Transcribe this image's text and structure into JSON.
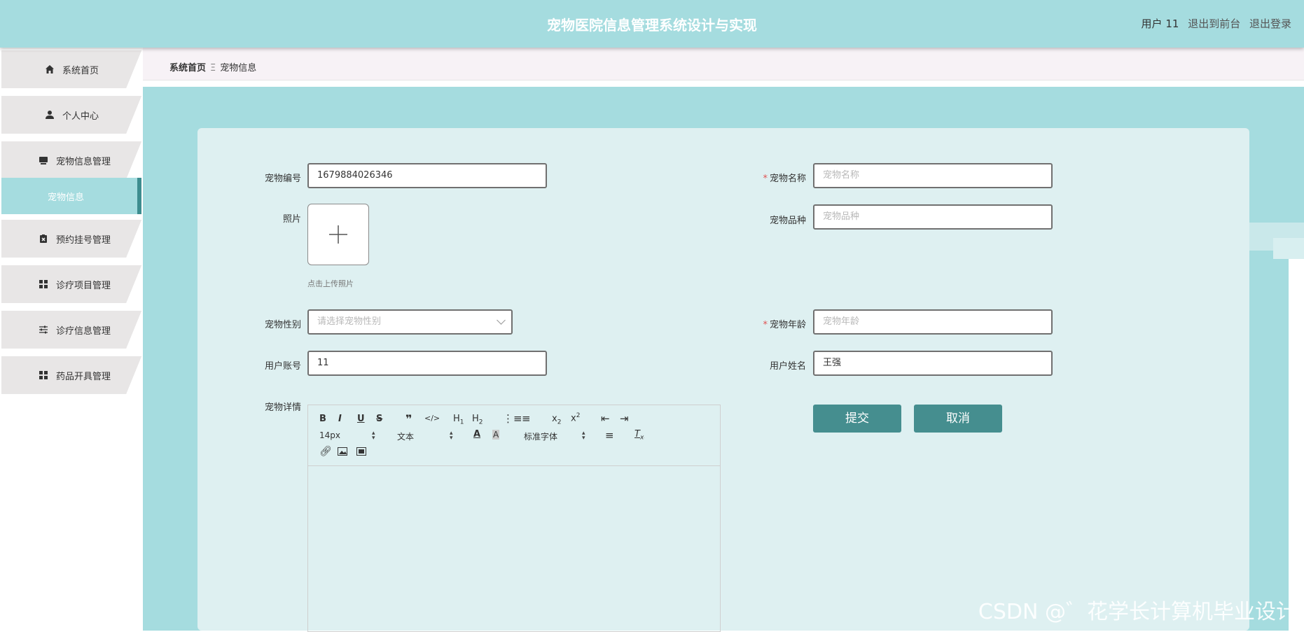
{
  "header": {
    "title": "宠物医院信息管理系统设计与实现",
    "user_label": "用户 11",
    "front_link": "退出到前台",
    "logout_link": "退出登录"
  },
  "sidebar": {
    "items": [
      {
        "label": "系统首页",
        "icon": "home-icon"
      },
      {
        "label": "个人中心",
        "icon": "user-icon"
      },
      {
        "label": "宠物信息管理",
        "icon": "monitor-icon"
      },
      {
        "label": "预约挂号管理",
        "icon": "clipboard-icon"
      },
      {
        "label": "诊疗项目管理",
        "icon": "grid-icon"
      },
      {
        "label": "诊疗信息管理",
        "icon": "sliders-icon"
      },
      {
        "label": "药品开具管理",
        "icon": "grid-icon"
      }
    ],
    "submenu_active": "宠物信息"
  },
  "breadcrumb": {
    "root": "系统首页",
    "separator": "Ξ",
    "current": "宠物信息"
  },
  "form": {
    "pet_no": {
      "label": "宠物编号",
      "value": "1679884026346"
    },
    "pet_name": {
      "label": "宠物名称",
      "placeholder": "宠物名称",
      "required": true
    },
    "photo": {
      "label": "照片",
      "tip": "点击上传照片"
    },
    "pet_breed": {
      "label": "宠物品种",
      "placeholder": "宠物品种"
    },
    "pet_gender": {
      "label": "宠物性别",
      "placeholder": "请选择宠物性别"
    },
    "pet_age": {
      "label": "宠物年龄",
      "placeholder": "宠物年龄",
      "required": true
    },
    "user_account": {
      "label": "用户账号",
      "value": "11"
    },
    "user_name": {
      "label": "用户姓名",
      "value": "王强"
    },
    "details": {
      "label": "宠物详情"
    }
  },
  "editor": {
    "font_size": "14px",
    "text_style": "文本",
    "font_family": "标准字体"
  },
  "buttons": {
    "submit": "提交",
    "cancel": "取消"
  },
  "watermark": "CSDN @゛花学长计算机毕业设计",
  "colors": {
    "header": "#a5dcdf",
    "accent": "#458e8f",
    "card": "#def0f1"
  }
}
